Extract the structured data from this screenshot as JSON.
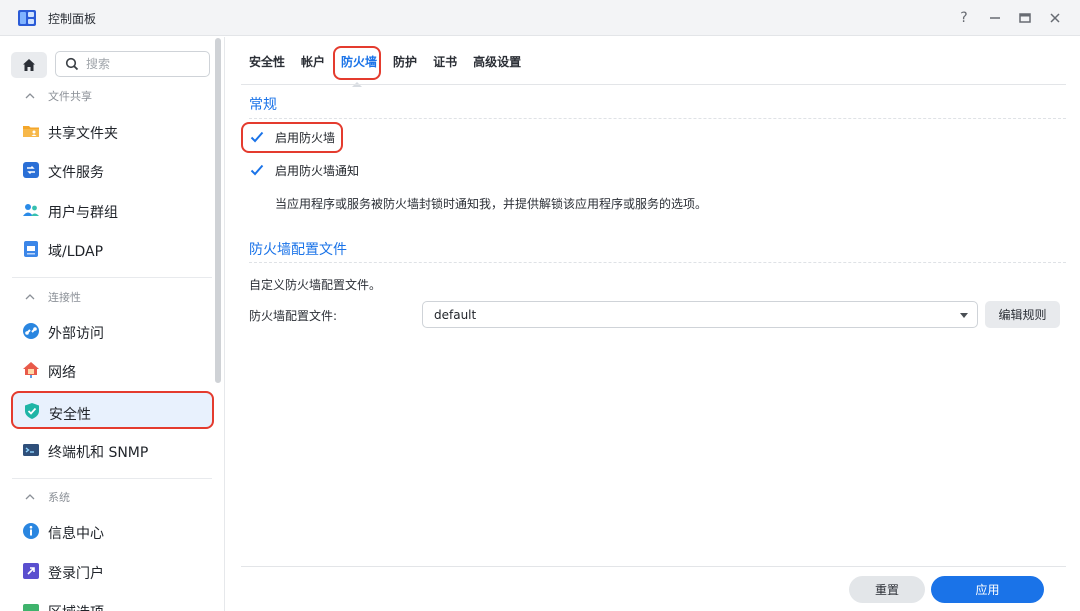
{
  "window": {
    "title": "控制面板",
    "help_glyph": "?",
    "icons": [
      "help-icon",
      "minimize-icon",
      "maximize-icon",
      "close-icon"
    ]
  },
  "sidebar": {
    "search_placeholder": "搜索",
    "sections": [
      {
        "label": "文件共享",
        "items": [
          "共享文件夹",
          "文件服务",
          "用户与群组",
          "域/LDAP"
        ]
      },
      {
        "label": "连接性",
        "items": [
          "外部访问",
          "网络",
          "安全性",
          "终端机和 SNMP"
        ]
      },
      {
        "label": "系统",
        "items": [
          "信息中心",
          "登录门户",
          "区域选项"
        ]
      }
    ],
    "selected": "安全性"
  },
  "tabs": [
    "安全性",
    "帐户",
    "防火墙",
    "防护",
    "证书",
    "高级设置"
  ],
  "active_tab": "防火墙",
  "general": {
    "title": "常规",
    "enable_firewall": {
      "label": "启用防火墙",
      "checked": true
    },
    "enable_notify": {
      "label": "启用防火墙通知",
      "checked": true
    },
    "description": "当应用程序或服务被防火墙封锁时通知我，并提供解锁该应用程序或服务的选项。"
  },
  "profile": {
    "title": "防火墙配置文件",
    "intro": "自定义防火墙配置文件。",
    "field_label": "防火墙配置文件:",
    "selected_value": "default",
    "edit_button": "编辑规则"
  },
  "footer": {
    "reset": "重置",
    "apply": "应用"
  },
  "colors": {
    "accent": "#1a73e8",
    "highlight": "#e43b2e",
    "selected_bg": "#e8f1fd"
  }
}
